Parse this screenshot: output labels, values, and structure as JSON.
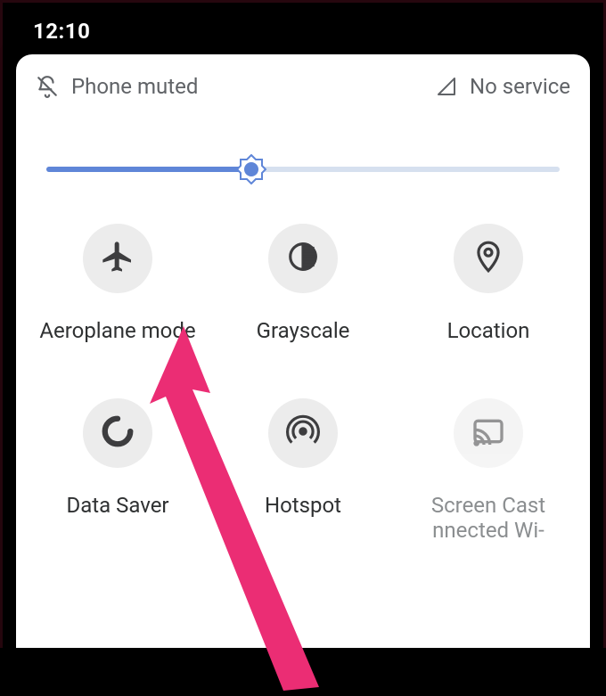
{
  "status_bar": {
    "time": "12:10"
  },
  "panel": {
    "left_status": {
      "label": "Phone muted"
    },
    "right_status": {
      "label": "No service"
    },
    "brightness": {
      "percent": 40
    },
    "tiles": [
      {
        "id": "aeroplane-mode",
        "label": "Aeroplane mode",
        "disabled": false
      },
      {
        "id": "grayscale",
        "label": "Grayscale",
        "disabled": false
      },
      {
        "id": "location",
        "label": "Location",
        "disabled": false
      },
      {
        "id": "data-saver",
        "label": "Data Saver",
        "disabled": false
      },
      {
        "id": "hotspot",
        "label": "Hotspot",
        "disabled": false
      },
      {
        "id": "screen-cast",
        "label": "Screen Cast\nnnected          Wi-",
        "disabled": true
      }
    ]
  },
  "annotation": {
    "arrow_target": "aeroplane-mode"
  }
}
